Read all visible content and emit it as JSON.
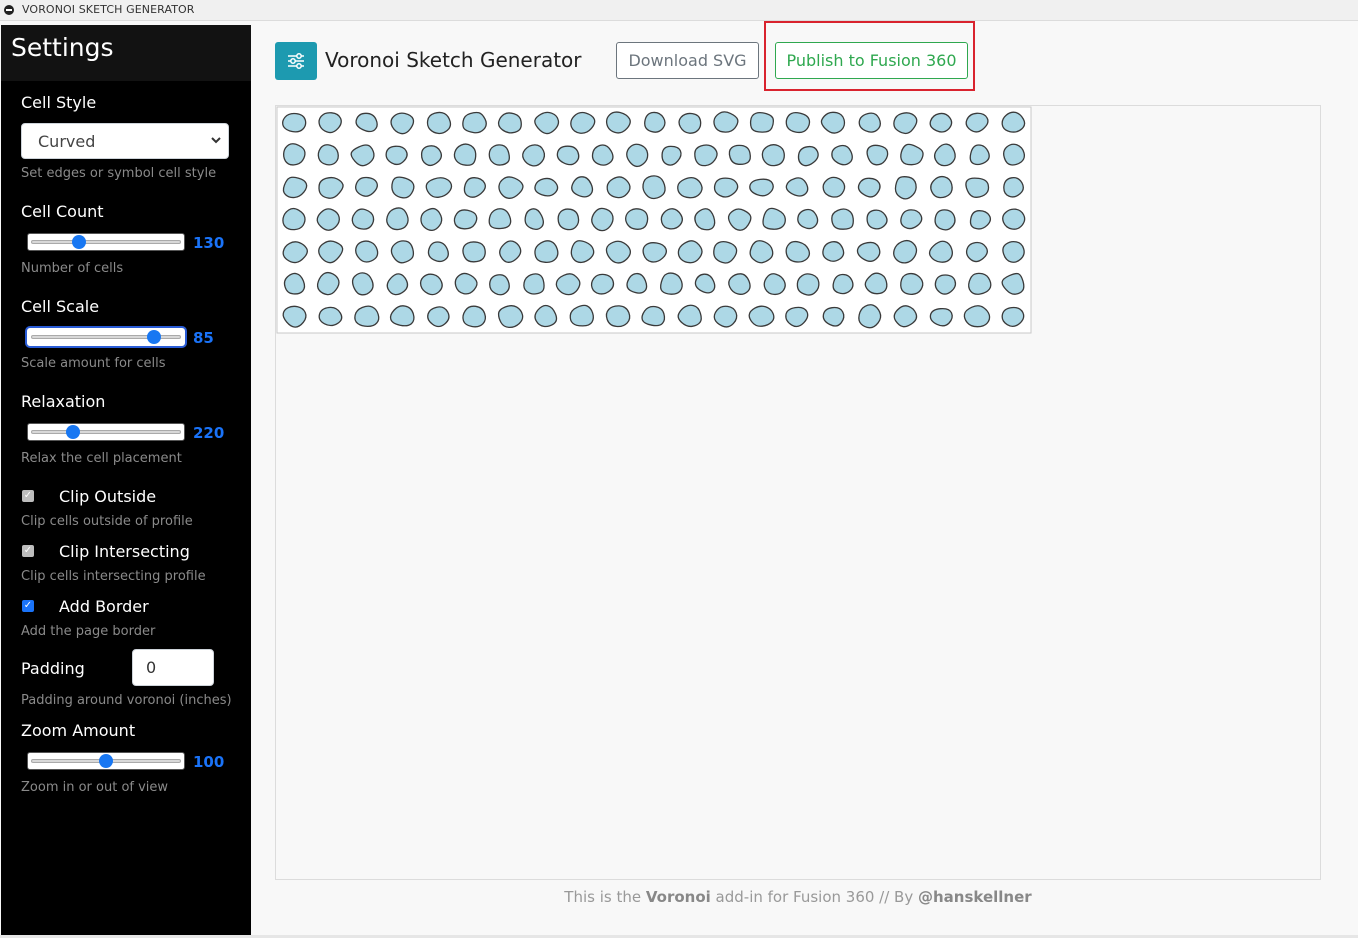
{
  "window": {
    "title": "VORONOI SKETCH GENERATOR"
  },
  "sidebar": {
    "heading": "Settings",
    "cell_style": {
      "label": "Cell Style",
      "value": "Curved",
      "help": "Set edges or symbol cell style"
    },
    "cell_count": {
      "label": "Cell Count",
      "value": "130",
      "fraction": 0.3,
      "help": "Number of cells"
    },
    "cell_scale": {
      "label": "Cell Scale",
      "value": "85",
      "fraction": 0.85,
      "help": "Scale amount for cells"
    },
    "relaxation": {
      "label": "Relaxation",
      "value": "220",
      "fraction": 0.26,
      "help": "Relax the cell placement"
    },
    "clip_outside": {
      "label": "Clip Outside",
      "checked": true,
      "disabled": true,
      "help": "Clip cells outside of profile"
    },
    "clip_intersecting": {
      "label": "Clip Intersecting",
      "checked": true,
      "disabled": true,
      "help": "Clip cells intersecting profile"
    },
    "add_border": {
      "label": "Add Border",
      "checked": true,
      "disabled": false,
      "help": "Add the page border"
    },
    "padding": {
      "label": "Padding",
      "value": "0",
      "help": "Padding around voronoi (inches)"
    },
    "zoom": {
      "label": "Zoom Amount",
      "value": "100",
      "fraction": 0.5,
      "help": "Zoom in or out of view"
    }
  },
  "header": {
    "title": "Voronoi Sketch Generator",
    "download_label": "Download SVG",
    "publish_label": "Publish to Fusion 360"
  },
  "footer": {
    "prefix": "This is the ",
    "addin": "Voronoi",
    "middle": " add-in for Fusion 360 // By ",
    "author": "@hanskellner"
  },
  "colors": {
    "cell_fill": "#add8e6",
    "cell_stroke": "#3a3a3a",
    "accent": "#1a73f8",
    "publish": "#2fa84f",
    "highlight": "#d9232e",
    "logo": "#1d9ab0"
  },
  "icons": {
    "logo": "sliders-icon",
    "select": "chevron-down-icon",
    "window": "minimize-icon"
  }
}
